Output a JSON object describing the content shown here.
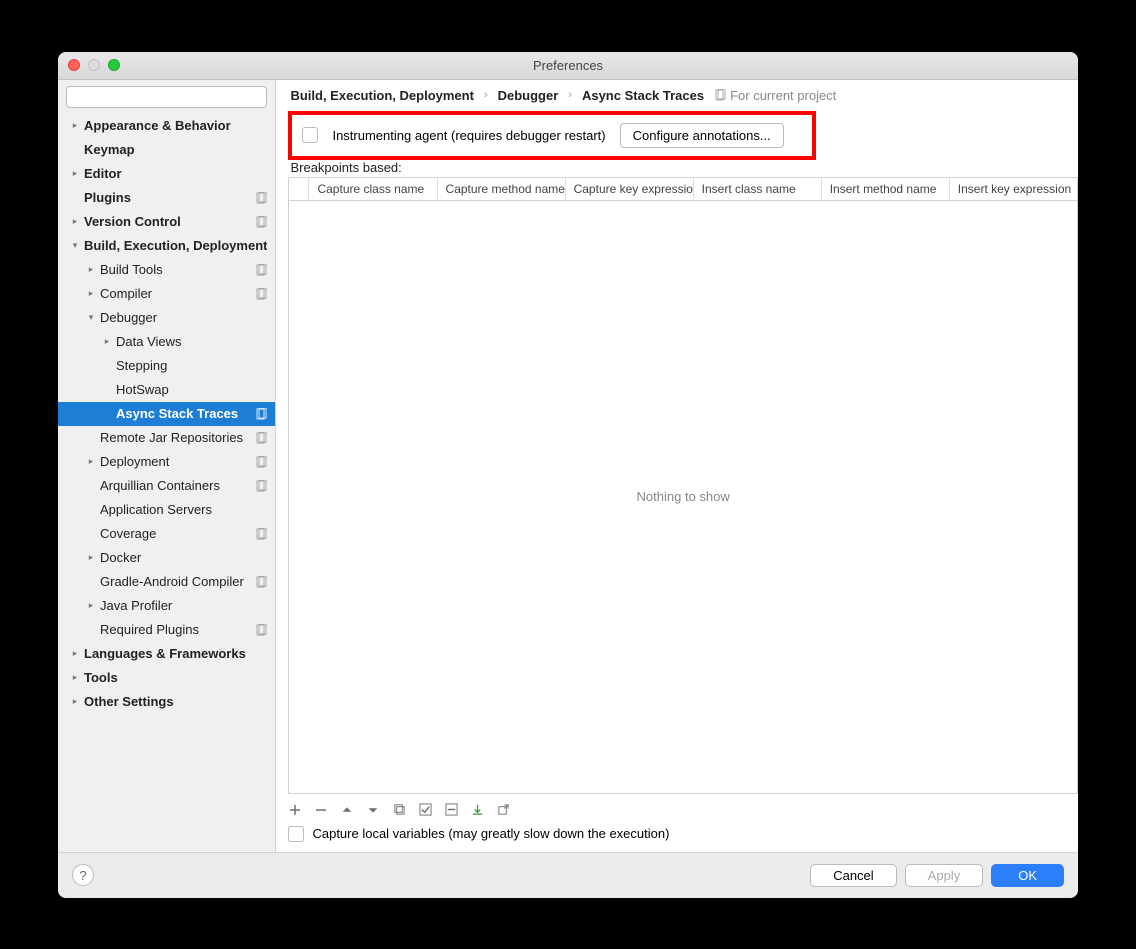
{
  "window": {
    "title": "Preferences"
  },
  "search": {
    "placeholder": ""
  },
  "sidebar": {
    "items": [
      {
        "label": "Appearance & Behavior",
        "bold": true,
        "chevron": "right",
        "indent": 0,
        "proj": false
      },
      {
        "label": "Keymap",
        "bold": true,
        "chevron": "none",
        "indent": 0,
        "proj": false
      },
      {
        "label": "Editor",
        "bold": true,
        "chevron": "right",
        "indent": 0,
        "proj": false
      },
      {
        "label": "Plugins",
        "bold": true,
        "chevron": "none",
        "indent": 0,
        "proj": true
      },
      {
        "label": "Version Control",
        "bold": true,
        "chevron": "right",
        "indent": 0,
        "proj": true
      },
      {
        "label": "Build, Execution, Deployment",
        "bold": true,
        "chevron": "down",
        "indent": 0,
        "proj": false
      },
      {
        "label": "Build Tools",
        "bold": false,
        "chevron": "right",
        "indent": 1,
        "proj": true
      },
      {
        "label": "Compiler",
        "bold": false,
        "chevron": "right",
        "indent": 1,
        "proj": true
      },
      {
        "label": "Debugger",
        "bold": false,
        "chevron": "down",
        "indent": 1,
        "proj": false
      },
      {
        "label": "Data Views",
        "bold": false,
        "chevron": "right",
        "indent": 2,
        "proj": false
      },
      {
        "label": "Stepping",
        "bold": false,
        "chevron": "none",
        "indent": 2,
        "proj": false
      },
      {
        "label": "HotSwap",
        "bold": false,
        "chevron": "none",
        "indent": 2,
        "proj": false
      },
      {
        "label": "Async Stack Traces",
        "bold": true,
        "chevron": "none",
        "indent": 2,
        "proj": true,
        "selected": true
      },
      {
        "label": "Remote Jar Repositories",
        "bold": false,
        "chevron": "none",
        "indent": 1,
        "proj": true
      },
      {
        "label": "Deployment",
        "bold": false,
        "chevron": "right",
        "indent": 1,
        "proj": true
      },
      {
        "label": "Arquillian Containers",
        "bold": false,
        "chevron": "none",
        "indent": 1,
        "proj": true
      },
      {
        "label": "Application Servers",
        "bold": false,
        "chevron": "none",
        "indent": 1,
        "proj": false
      },
      {
        "label": "Coverage",
        "bold": false,
        "chevron": "none",
        "indent": 1,
        "proj": true
      },
      {
        "label": "Docker",
        "bold": false,
        "chevron": "right",
        "indent": 1,
        "proj": false
      },
      {
        "label": "Gradle-Android Compiler",
        "bold": false,
        "chevron": "none",
        "indent": 1,
        "proj": true
      },
      {
        "label": "Java Profiler",
        "bold": false,
        "chevron": "right",
        "indent": 1,
        "proj": false
      },
      {
        "label": "Required Plugins",
        "bold": false,
        "chevron": "none",
        "indent": 1,
        "proj": true
      },
      {
        "label": "Languages & Frameworks",
        "bold": true,
        "chevron": "right",
        "indent": 0,
        "proj": false
      },
      {
        "label": "Tools",
        "bold": true,
        "chevron": "right",
        "indent": 0,
        "proj": false
      },
      {
        "label": "Other Settings",
        "bold": true,
        "chevron": "right",
        "indent": 0,
        "proj": false
      }
    ]
  },
  "breadcrumb": {
    "items": [
      "Build, Execution, Deployment",
      "Debugger",
      "Async Stack Traces"
    ],
    "project_scope": "For current project"
  },
  "instrument": {
    "label": "Instrumenting agent (requires debugger restart)",
    "button": "Configure annotations..."
  },
  "breakpoints_label": "Breakpoints based:",
  "table": {
    "headers": [
      "Capture class name",
      "Capture method name",
      "Capture key expression",
      "Insert class name",
      "Insert method name",
      "Insert key expression"
    ],
    "empty": "Nothing to show"
  },
  "capture_local": "Capture local variables (may greatly slow down the execution)",
  "footer": {
    "cancel": "Cancel",
    "apply": "Apply",
    "ok": "OK",
    "help": "?"
  }
}
